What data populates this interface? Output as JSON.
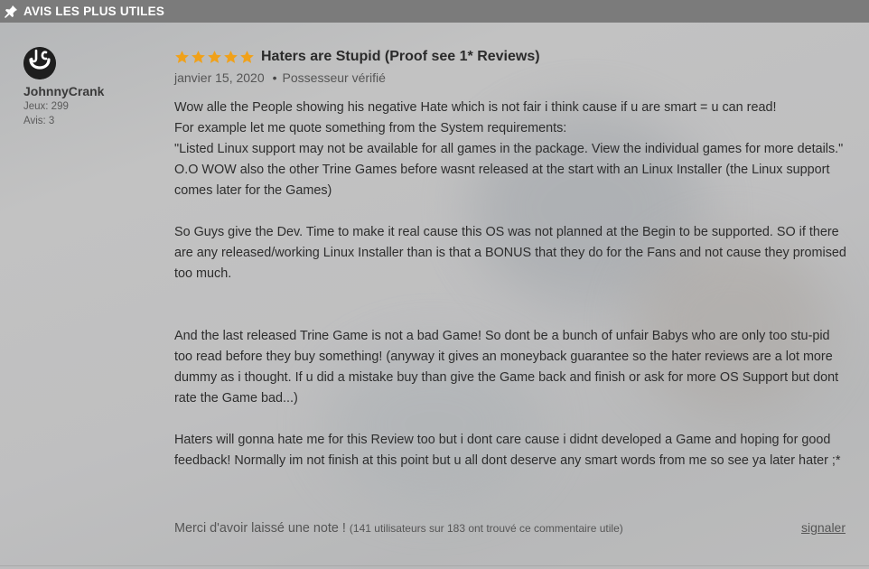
{
  "section": {
    "title": "AVIS LES PLUS UTILES",
    "icon": "pin-icon"
  },
  "reviewer": {
    "name": "JohnnyCrank",
    "games": "Jeux: 299",
    "reviews": "Avis: 3",
    "avatar_icon": "avatar-icon"
  },
  "review": {
    "rating": 5,
    "title": "Haters are Stupid (Proof see 1* Reviews)",
    "date": "janvier 15, 2020",
    "separator": "•",
    "owner_label": "Possesseur vérifié",
    "paragraphs": [
      "Wow alle the People showing his negative Hate which is not fair i think cause if u are smart = u can read!\nFor example let me quote something from the System requirements:\n\"Listed Linux support may not be available for all games in the package. View the individual games for more details.\" O.O WOW also the other Trine Games before wasnt released at the start with an Linux Installer (the Linux support comes later for the Games)",
      "So Guys give the Dev. Time to make it real cause this OS was not planned at the Begin to be supported. SO if there are any released/working Linux Installer than is that a BONUS that they do for the Fans and not cause they promised too much.",
      "And the last released Trine Game is not a bad Game! So dont be a bunch of unfair Babys who are only too stu-pid too read before they buy something! (anyway it gives an moneyback guarantee so the hater reviews are a lot more dummy as i thought. If u did a mistake buy than give the Game back and finish or ask for more OS Support but dont rate the Game bad...)",
      "Haters will gonna hate me for this Review too but i dont care cause i didnt developed a Game and hoping for good feedback! Normally im not finish at this point but u all dont deserve any smart words from me so see ya later hater ;*"
    ],
    "helpful_question": "Merci d'avoir laissé une note !",
    "helpful_count": "(141 utilisateurs sur 183 ont trouvé ce commentaire utile)",
    "report_label": "signaler"
  },
  "colors": {
    "header_bg": "#7b7b7b",
    "star": "#f0a11a",
    "text": "#2d2d2d"
  }
}
